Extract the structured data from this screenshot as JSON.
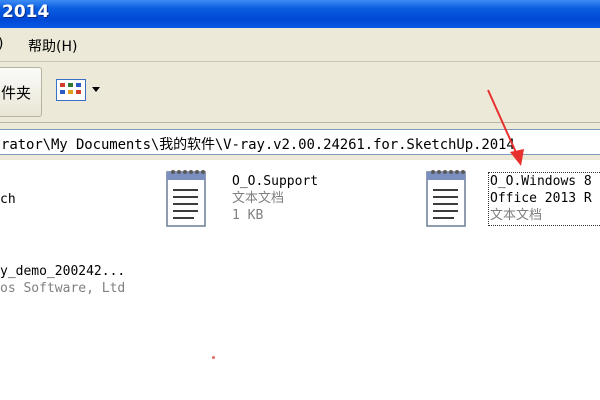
{
  "window": {
    "title": "2014"
  },
  "menubar": {
    "items": [
      {
        "label": ")"
      },
      {
        "label": "帮助(H)"
      }
    ]
  },
  "toolbar": {
    "folders_label": "件夹",
    "view_button_icon": "view-grid-icon"
  },
  "address": {
    "value": "rator\\My Documents\\我的软件\\V-ray.v2.00.24261.for.SketchUp.2014"
  },
  "files": [
    {
      "name": "ch",
      "type": "",
      "size": "",
      "icon": "none",
      "selected": false
    },
    {
      "name": "O_O.Support",
      "type": "文本文档",
      "size": "1 KB",
      "icon": "notepad-icon",
      "selected": false
    },
    {
      "name": "O_O.Windows 8",
      "name2": "Office 2013 R",
      "type": "文本文档",
      "size": "",
      "icon": "notepad-icon",
      "selected": true
    },
    {
      "name": "y_demo_200242...",
      "type": "os Software, Ltd",
      "size": "",
      "icon": "none",
      "selected": false
    }
  ],
  "annotation": {
    "type": "arrow",
    "color": "#e8312f"
  },
  "colors": {
    "titlebar": "#0a5ee0",
    "menubar": "#ece9d8",
    "annotation": "#e8312f"
  }
}
